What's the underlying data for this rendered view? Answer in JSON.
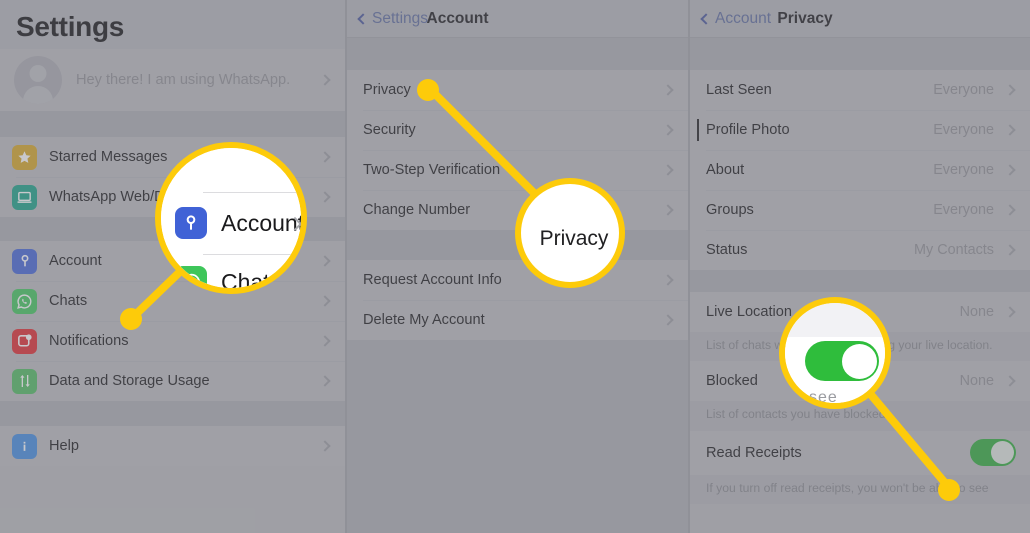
{
  "app": {
    "name": "WhatsApp iOS Settings",
    "accent_yellow": "#fdcb0a",
    "toggle_green": "#2bab38",
    "link_blue": "#44549a"
  },
  "left_panel": {
    "title": "Settings",
    "profile": {
      "status_text": "Hey there! I am using WhatsApp.",
      "avatar_icon": "person-avatar-icon",
      "chevron": "chevron-right-icon"
    },
    "group1": [
      {
        "label": "Starred Messages",
        "icon": "star-icon",
        "icon_color": "#d6a521"
      },
      {
        "label": "WhatsApp Web/Desktop",
        "icon": "laptop-icon",
        "icon_color": "#16a085"
      }
    ],
    "group2": [
      {
        "label": "Account",
        "icon": "key-icon",
        "icon_color": "#4062d6"
      },
      {
        "label": "Chats",
        "icon": "whatsapp-icon",
        "icon_color": "#3ec65a"
      },
      {
        "label": "Notifications",
        "icon": "notification-icon",
        "icon_color": "#e0262b"
      },
      {
        "label": "Data and Storage Usage",
        "icon": "data-arrows-icon",
        "icon_color": "#4cbb5e"
      }
    ],
    "group3": [
      {
        "label": "Help",
        "icon": "info-icon",
        "icon_color": "#3f8ae0"
      }
    ]
  },
  "mid_panel": {
    "nav": {
      "back_label": "Settings",
      "title": "Account",
      "back_icon": "chevron-left-icon"
    },
    "group1": [
      {
        "label": "Privacy"
      },
      {
        "label": "Security"
      },
      {
        "label": "Two-Step Verification"
      },
      {
        "label": "Change Number"
      }
    ],
    "group2": [
      {
        "label": "Request Account Info"
      },
      {
        "label": "Delete My Account"
      }
    ]
  },
  "right_panel": {
    "nav": {
      "back_label": "Account",
      "title": "Privacy",
      "back_icon": "chevron-left-icon"
    },
    "group1": [
      {
        "label": "Last Seen",
        "value": "Everyone"
      },
      {
        "label": "Profile Photo",
        "value": "Everyone"
      },
      {
        "label": "About",
        "value": "Everyone"
      },
      {
        "label": "Groups",
        "value": "Everyone"
      },
      {
        "label": "Status",
        "value": "My Contacts"
      }
    ],
    "live_location": {
      "label": "Live Location",
      "value": "None",
      "footnote": "List of chats where you are sharing your live location."
    },
    "blocked": {
      "label": "Blocked",
      "value": "None",
      "footnote": "List of contacts you have blocked."
    },
    "read_receipts": {
      "label": "Read Receipts",
      "toggle_state": "on",
      "footnote": "If you turn off read receipts, you won't be able to see"
    }
  },
  "callouts": {
    "account": {
      "magnified_rows": [
        "Account",
        "Chats"
      ],
      "target": "Account"
    },
    "privacy": {
      "magnified_text": "Privacy",
      "target": "Privacy"
    },
    "toggle": {
      "magnified_control": "read-receipts-toggle",
      "state": "on",
      "ghost_text": "see"
    }
  }
}
